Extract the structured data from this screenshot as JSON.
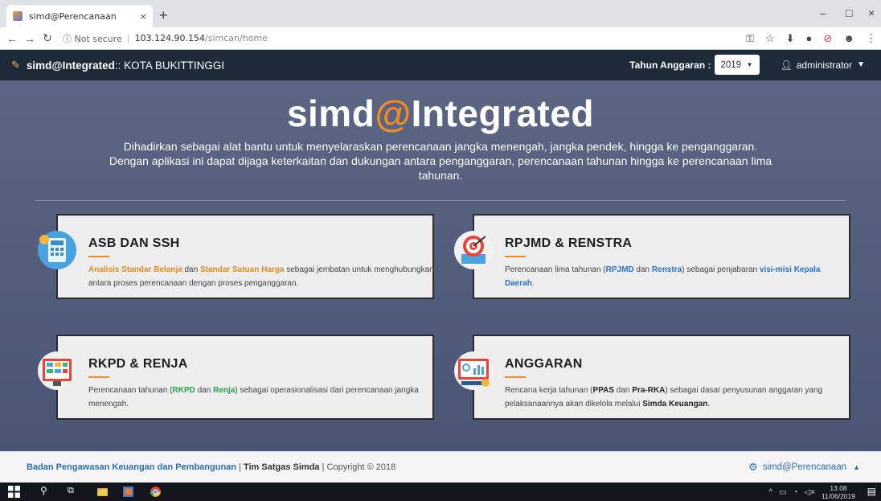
{
  "browser": {
    "tab_title": "simd@Perencanaan",
    "tab_close": "×",
    "new_tab": "+",
    "security": "ⓘ Not secure",
    "url_host": "103.124.90.154",
    "url_path": "/simcan/home"
  },
  "navbar": {
    "brand_bold": "simd@Integrated",
    "brand_rest": " :: KOTA BUKITTINGGI",
    "tahun_label": "Tahun Anggaran :",
    "tahun_value": "2019",
    "user": "administrator"
  },
  "hero": {
    "title_a": "simd",
    "title_at": "@",
    "title_b": "Integrated",
    "desc": "Dihadirkan sebagai alat bantu untuk menyelaraskan perencanaan jangka menengah, jangka pendek, hingga ke penganggaran. Dengan aplikasi ini dapat dijaga keterkaitan dan dukungan antara penganggaran, perencanaan tahunan hingga ke perencanaan lima tahunan."
  },
  "cards": {
    "asb": {
      "title": "ASB DAN SSH",
      "p1": "Analisis Standar Belanja",
      "p2": " dan ",
      "p3": "Standar Satuan Harga",
      "p4": " sebagai jembatan untuk menghubungkan antara proses perencanaan dengan proses penganggaran."
    },
    "rpjmd": {
      "title": "RPJMD & RENSTRA",
      "p1": "Perencanaan lima tahunan (",
      "p2": "RPJMD",
      "p3": " dan ",
      "p4": "Renstra",
      "p5": ") sebagai penjabaran ",
      "p6": "visi-misi Kepala Daerah",
      "p7": "."
    },
    "rkpd": {
      "title": "RKPD & RENJA",
      "p1": "Perencanaan tahunan (",
      "p2": "RKPD",
      "p3": " dan ",
      "p4": "Renja",
      "p5": ") sebagai operasionalisasi dari perencanaan jangka menengah."
    },
    "anggaran": {
      "title": "ANGGARAN",
      "p1": "Rencana kerja tahunan (",
      "p2": "PPAS",
      "p3": " dan ",
      "p4": "Pra-RKA",
      "p5": ") sebagai dasar penyusunan anggaran yang pelaksanaannya akan dikelola melalui ",
      "p6": "Simda Keuangan",
      "p7": "."
    }
  },
  "footer": {
    "agency": "Badan Pengawasan Keuangan dan Pembangunan",
    "sep1": " | ",
    "team": "Tim Satgas Simda",
    "copyright": " | Copyright © 2018",
    "right": "simd@Perencanaan"
  },
  "taskbar": {
    "time": "13.08",
    "date": "11/06/2019"
  },
  "colors": {
    "accent": "#f08a24",
    "navbar": "#1d2a3a",
    "hero_top": "#5b6684",
    "link_blue": "#2a6fd6",
    "green": "#22a34a"
  }
}
